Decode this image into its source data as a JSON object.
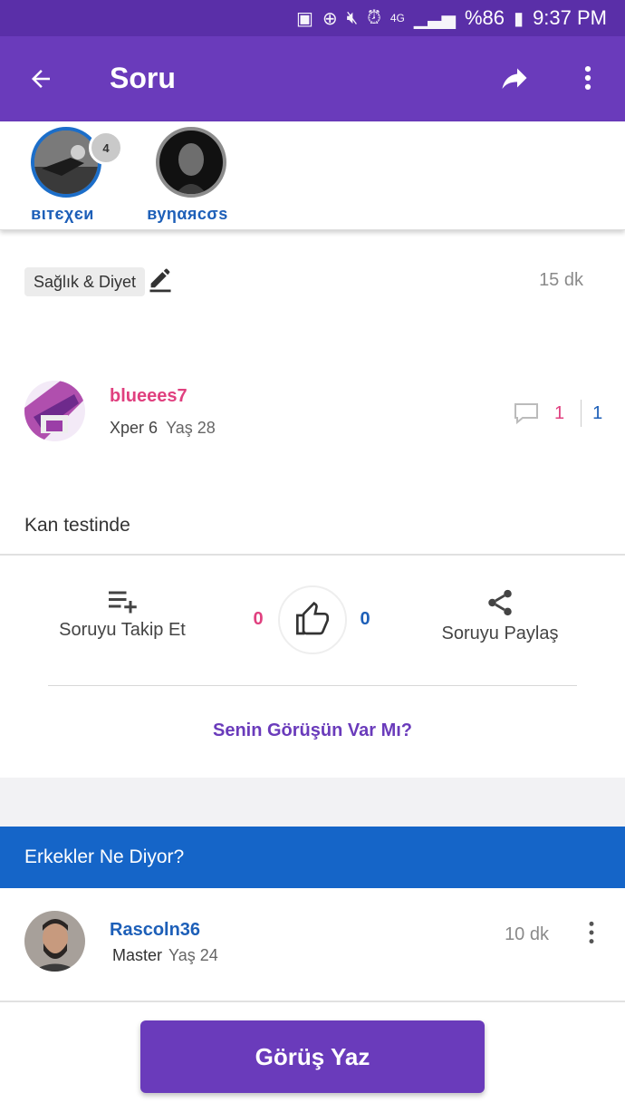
{
  "status_bar": {
    "battery": "%86",
    "time": "9:37 PM",
    "network": "4G"
  },
  "app_bar": {
    "title": "Soru",
    "back_icon": "arrow-left-icon",
    "share_icon": "share-arrow-icon",
    "more_icon": "more-vert-icon"
  },
  "stories": [
    {
      "name": "вιтєχєи",
      "badge": "4"
    },
    {
      "name": "вуηαяcσѕ"
    }
  ],
  "question": {
    "category": "Sağlık & Diyet",
    "time": "15 dk",
    "author": {
      "name": "blueees7",
      "level": "Xper 6",
      "age": "Yaş 28"
    },
    "comment_count": "1",
    "answer_count": "1",
    "text": "Kan testinde",
    "actions": {
      "follow_label": "Soruyu Takip Et",
      "share_label": "Soruyu Paylaş",
      "dislike_count": "0",
      "like_count": "0"
    },
    "opinion_prompt": "Senin Görüşün Var Mı?"
  },
  "answers_section": {
    "title": "Erkekler Ne Diyor?",
    "items": [
      {
        "name": "Rascoln36",
        "level": "Master",
        "age": "Yaş 24",
        "time": "10 dk"
      }
    ]
  },
  "write_button": "Görüş Yaz",
  "colors": {
    "primary": "#6a3bbb",
    "status_bar": "#5a2fa8",
    "pink": "#e0407f",
    "blue": "#1565c8"
  }
}
